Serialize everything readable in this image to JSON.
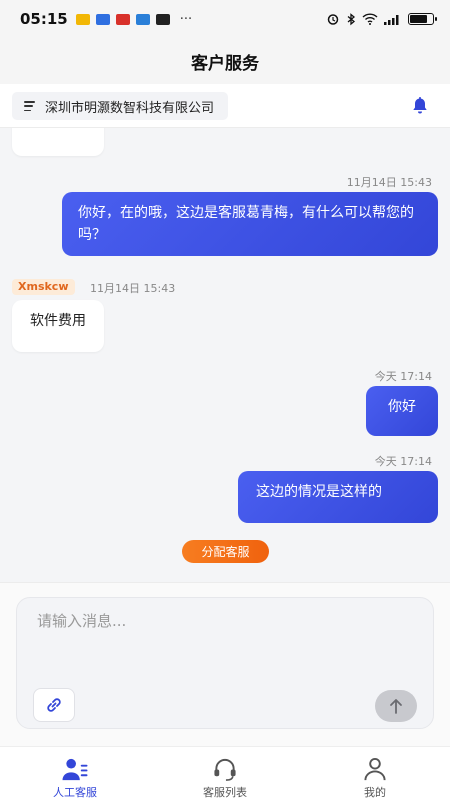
{
  "status_bar": {
    "time": "05:15",
    "more": "···",
    "battery_level": 0.8
  },
  "header": {
    "title": "客户服务"
  },
  "company": {
    "name": "深圳市明灏数智科技有限公司"
  },
  "messages": [
    {
      "side": "out",
      "time": "11月14日 15:43",
      "text": "你好，在的哦，这边是客服葛青梅，有什么可以帮您的吗？"
    },
    {
      "side": "in",
      "user": "Xmskcw",
      "time": "11月14日 15:43",
      "text": "软件费用"
    },
    {
      "side": "out",
      "time": "今天 17:14",
      "text": "你好"
    },
    {
      "side": "out",
      "time": "今天 17:14",
      "text": "这边的情况是这样的"
    }
  ],
  "assign_button": "分配客服",
  "composer": {
    "placeholder": "请输入消息..."
  },
  "tabs": [
    {
      "label": "人工客服",
      "icon": "customer-service-icon",
      "active": true
    },
    {
      "label": "客服列表",
      "icon": "headset-icon",
      "active": false
    },
    {
      "label": "我的",
      "icon": "person-icon",
      "active": false
    }
  ],
  "colors": {
    "accent": "#3346d8",
    "orange": "#f0620e"
  }
}
